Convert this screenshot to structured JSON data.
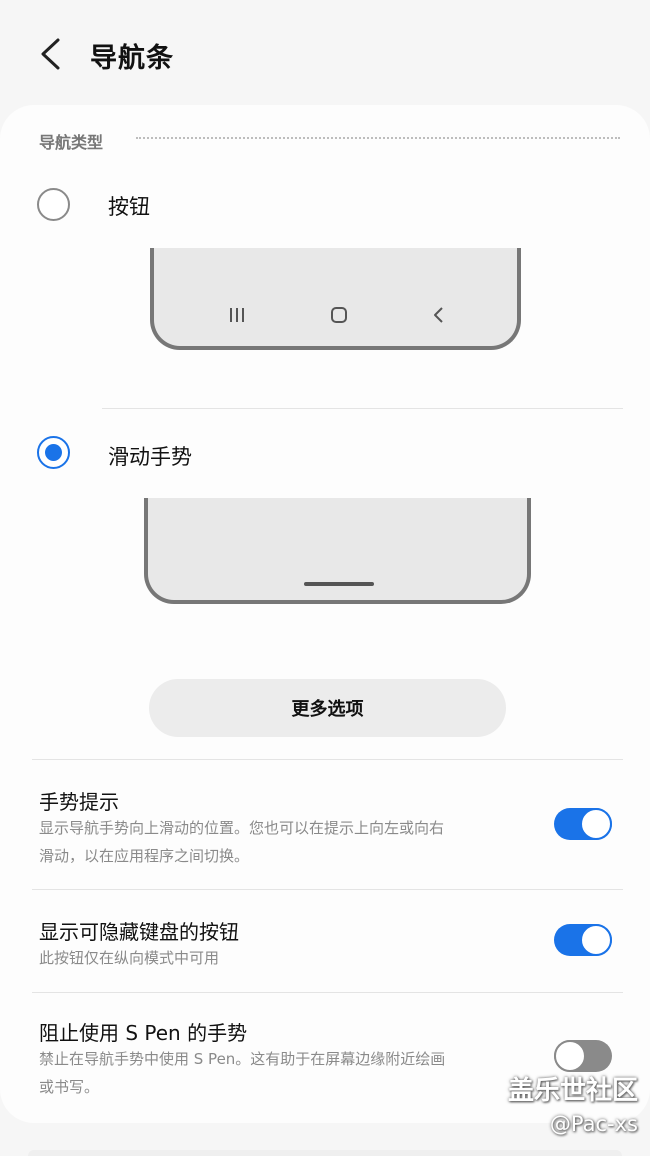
{
  "header": {
    "title": "导航条",
    "back_icon": "chevron-left-icon"
  },
  "section": {
    "title": "导航类型"
  },
  "options": [
    {
      "label": "按钮",
      "selected": false
    },
    {
      "label": "滑动手势",
      "selected": true
    }
  ],
  "more_button": {
    "label": "更多选项"
  },
  "settings": [
    {
      "title": "手势提示",
      "description_line1": "显示导航手势向上滑动的位置。您也可以在提示上向左或向右",
      "description_line2": "滑动，以在应用程序之间切换。",
      "enabled": true
    },
    {
      "title": "显示可隐藏键盘的按钮",
      "description_line1": "此按钮仅在纵向模式中可用",
      "enabled": true
    },
    {
      "title": "阻止使用 S Pen 的手势",
      "description_line1": "禁止在导航手势中使用 S Pen。这有助于在屏幕边缘附近绘画",
      "description_line2": "或书写。",
      "enabled": false
    }
  ],
  "watermark": {
    "brand": "盖乐世社区",
    "user": "@Pac-xs"
  },
  "colors": {
    "accent": "#1a73e8",
    "toggle_off": "#8a8a8a",
    "background": "#f6f6f6"
  }
}
